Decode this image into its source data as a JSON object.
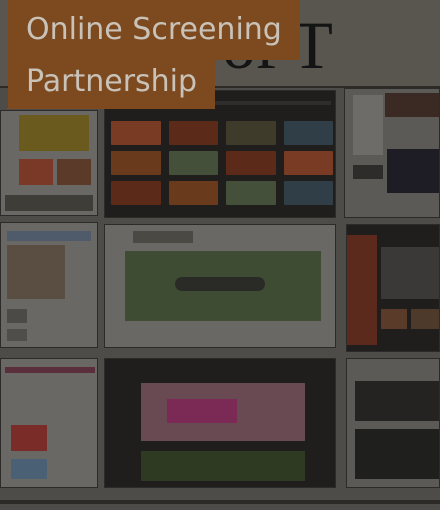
{
  "card": {
    "title_line_1": "Online Screening",
    "title_line_2": "Partnership",
    "background_text": "of T",
    "accent_color": "#7d4a1f"
  },
  "collage": {
    "image": "newspaper-website-collage"
  }
}
